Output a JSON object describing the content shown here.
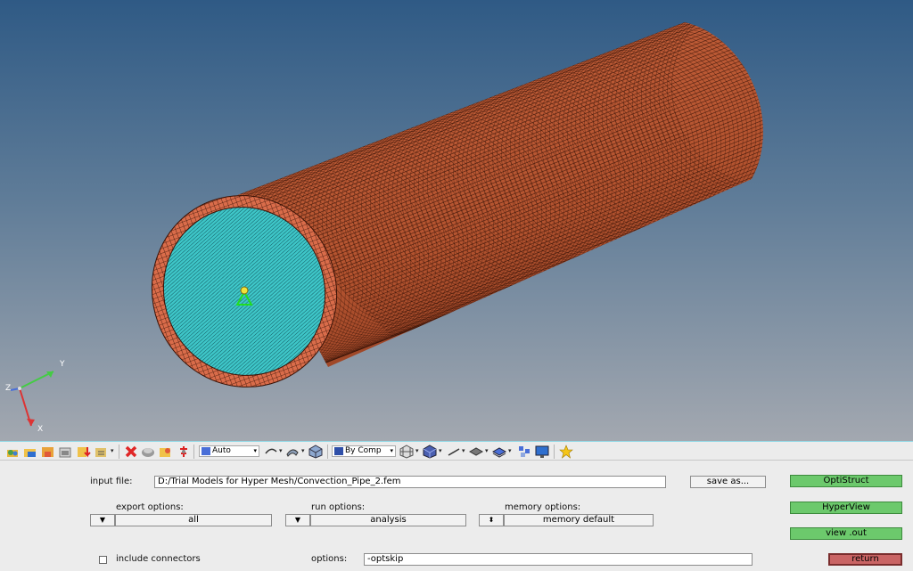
{
  "viewport": {
    "axis_labels": {
      "y": "Y",
      "z": "Z",
      "x": "X"
    },
    "colors": {
      "pipe": "#c8643e",
      "inner_face": "#3ec6c8",
      "mesh_line": "#2a0c04",
      "triad_y": "#44cc44",
      "triad_x": "#dd3333",
      "triad_z": "#4a6fd8"
    }
  },
  "toolbar": {
    "icons": [
      "open-model-icon",
      "import-icon",
      "save-model-icon",
      "print-icon",
      "export-icon",
      "solver-tool-icon",
      "delete-icon",
      "mask-icon",
      "find-icon",
      "reset-icon",
      "view-icon",
      "edges-icon",
      "wireframe-icon",
      "shade-icon",
      "by-comp-icon",
      "mesh-display-icon",
      "element-display-icon",
      "line-display-icon",
      "plane-display-icon",
      "layer-icon",
      "connector-icon",
      "monitor-icon",
      "favorites-icon"
    ],
    "auto_dropdown": "Auto",
    "color_mode_dropdown": "By Comp"
  },
  "panel": {
    "input_file_label": "input file:",
    "input_file_value": "D:/Trial Models for Hyper Mesh/Convection_Pipe_2.fem",
    "save_as_label": "save as...",
    "export_options_label": "export options:",
    "export_options_value": "all",
    "run_options_label": "run options:",
    "run_options_value": "analysis",
    "memory_options_label": "memory options:",
    "memory_options_value": "memory default",
    "include_connectors_label": "include connectors",
    "include_connectors_checked": false,
    "options_label": "options:",
    "options_value": "-optskip",
    "optistruct_label": "OptiStruct",
    "hyperview_label": "HyperView",
    "view_out_label": "view .out",
    "return_label": "return",
    "colors": {
      "green_button": "#6cc96c",
      "return_button": "#c96464"
    }
  }
}
